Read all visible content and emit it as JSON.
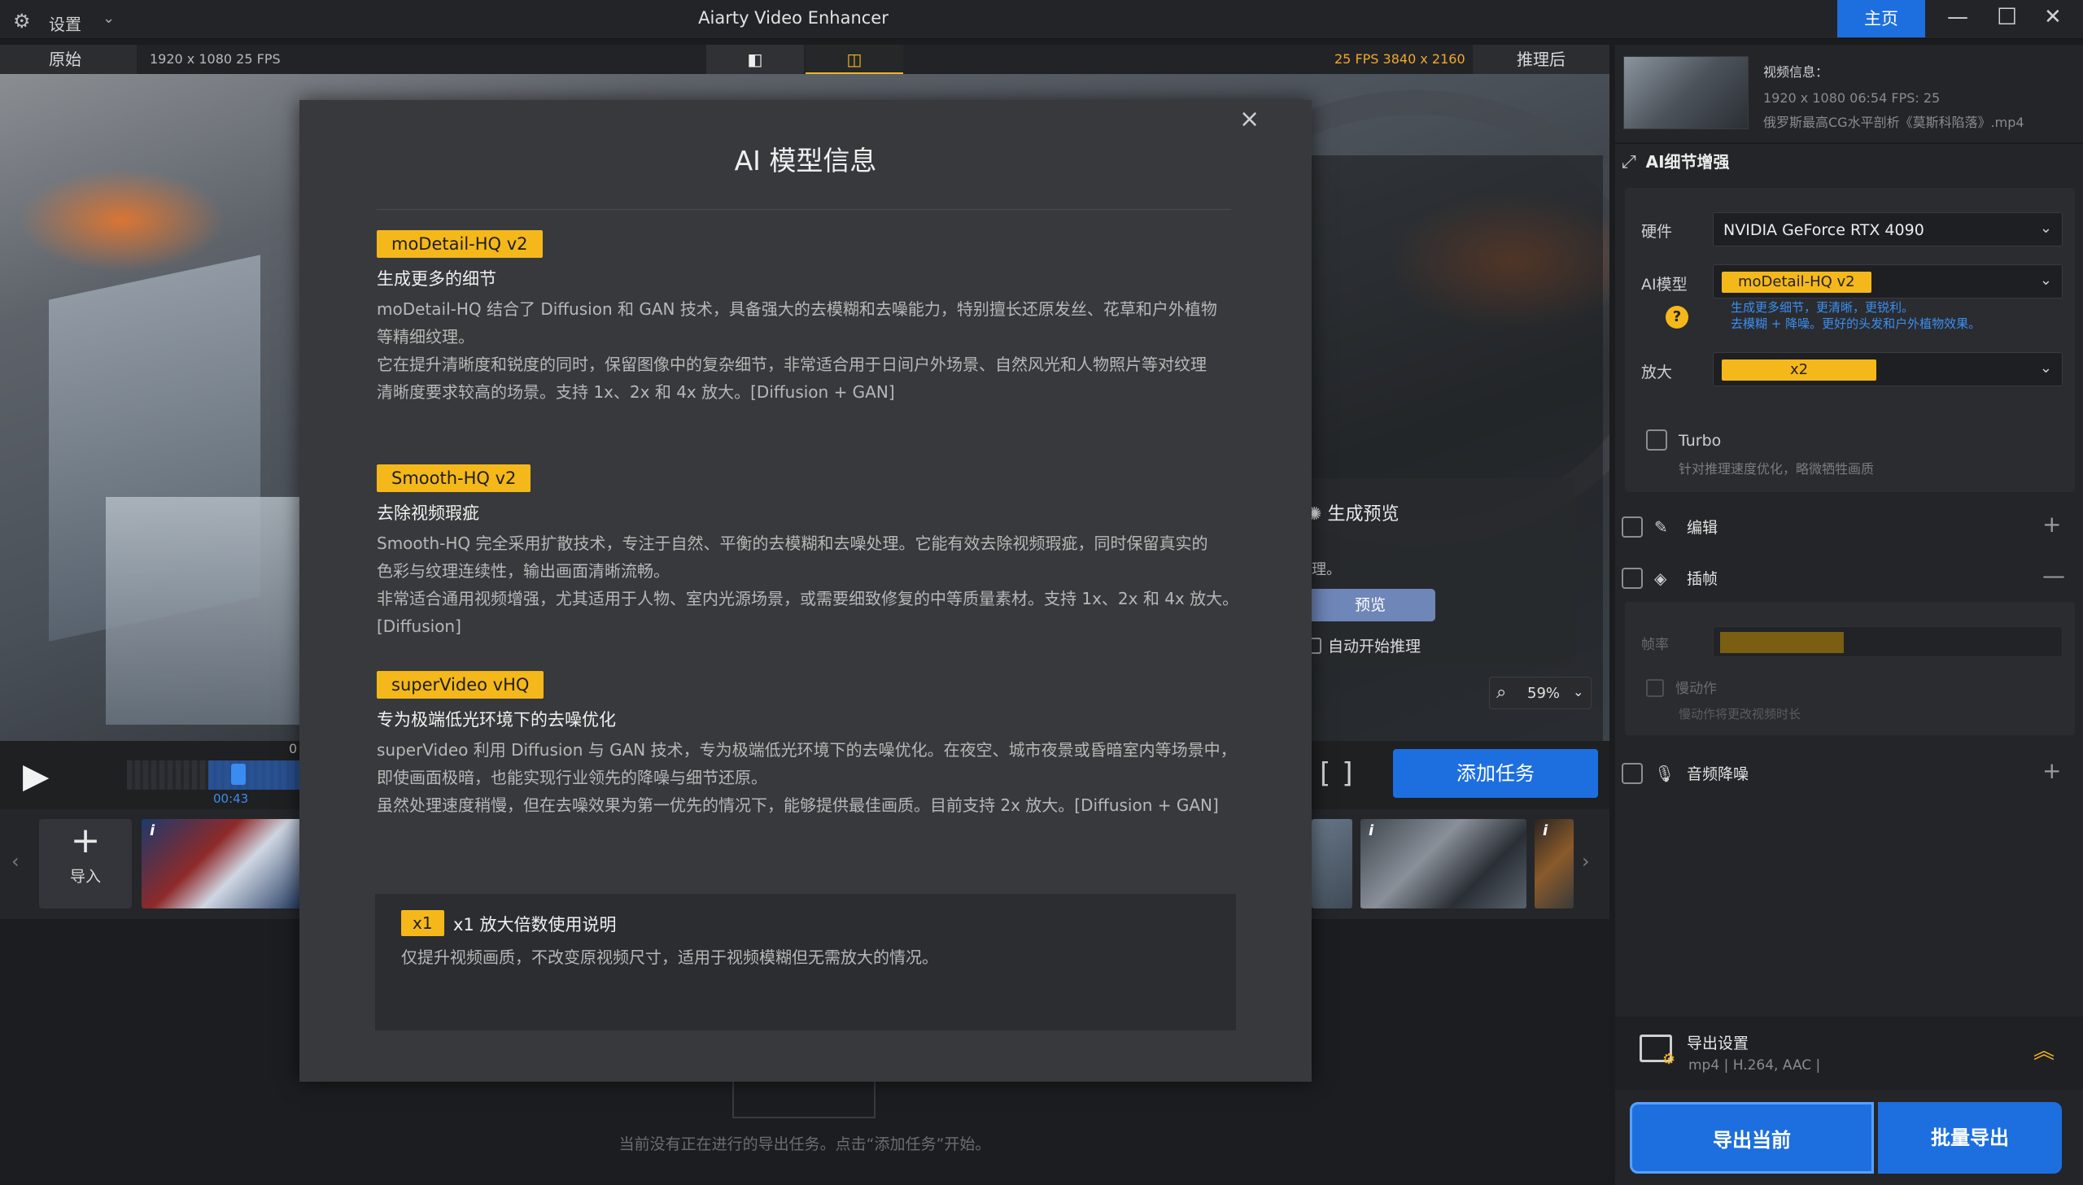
{
  "app": {
    "title": "Aiarty Video Enhancer",
    "settings_label": "设置",
    "home_button": "主页"
  },
  "preview": {
    "original_tab": "原始",
    "original_info": "1920 x 1080  25 FPS",
    "output_info": "25 FPS  3840 x 2160",
    "after_tab": "推理后",
    "generate_title": "生成预览",
    "generate_desc": "理。",
    "preview_button": "预览",
    "auto_start_label": "自动开始推理",
    "zoom_value": "59%",
    "time_label": "00:43",
    "time_zero": "0",
    "add_task_button": "添加任务"
  },
  "filmstrip": {
    "import_label": "导入"
  },
  "queue": {
    "empty_text": "当前没有正在进行的导出任务。点击“添加任务”开始。"
  },
  "right_panel": {
    "video_info_label": "视频信息：",
    "video_meta": "1920 x 1080  06:54    FPS: 25",
    "video_file": "俄罗斯最高CG水平剖析《莫斯科陷落》.mp4",
    "ai_section_title": "AI细节增强",
    "hardware_label": "硬件",
    "hardware_value": "NVIDIA GeForce RTX 4090",
    "model_label": "AI模型",
    "model_value": "moDetail-HQ  v2",
    "model_desc_line1": "生成更多细节，更清晰，更锐利。",
    "model_desc_line2": "去模糊 + 降噪。更好的头发和户外植物效果。",
    "scale_label": "放大",
    "scale_value": "x2",
    "turbo_label": "Turbo",
    "turbo_desc": "针对推理速度优化，略微牺牲画质",
    "edit_label": "编辑",
    "interp_label": "插帧",
    "interp_rate_label": "帧率",
    "interp_slow_label": "慢动作",
    "interp_slow_desc": "慢动作将更改视频时长",
    "audio_label": "音频降噪",
    "export_settings_title": "导出设置",
    "export_settings_sub": "mp4 | H.264, AAC |",
    "export_current": "导出当前",
    "export_batch": "批量导出"
  },
  "dialog": {
    "title": "AI 模型信息",
    "models": [
      {
        "tag": "moDetail-HQ  v2",
        "subtitle": "生成更多的细节",
        "p1": "moDetail-HQ 结合了 Diffusion 和 GAN 技术，具备强大的去模糊和去噪能力，特别擅长还原发丝、花草和户外植物",
        "p2": "等精细纹理。",
        "p3": "它在提升清晰度和锐度的同时，保留图像中的复杂细节，非常适合用于日间户外场景、自然风光和人物照片等对纹理",
        "p4": "清晰度要求较高的场景。支持 1x、2x 和 4x 放大。[Diffusion + GAN]"
      },
      {
        "tag": "Smooth-HQ  v2",
        "subtitle": "去除视频瑕疵",
        "p1": "Smooth-HQ 完全采用扩散技术，专注于自然、平衡的去模糊和去噪处理。它能有效去除视频瑕疵，同时保留真实的",
        "p2": "色彩与纹理连续性，输出画面清晰流畅。",
        "p3": "非常适合通用视频增强，尤其适用于人物、室内光源场景，或需要细致修复的中等质量素材。支持 1x、2x 和 4x 放大。",
        "p4": "[Diffusion]"
      },
      {
        "tag": "superVideo vHQ",
        "subtitle": "专为极端低光环境下的去噪优化",
        "p1": "superVideo 利用 Diffusion 与 GAN 技术，专为极端低光环境下的去噪优化。在夜空、城市夜景或昏暗室内等场景中，",
        "p2": "即使画面极暗，也能实现行业领先的降噪与细节还原。",
        "p3": "虽然处理速度稍慢，但在去噪效果为第一优先的情况下，能够提供最佳画质。目前支持 2x 放大。[Diffusion + GAN]",
        "p4": ""
      }
    ],
    "x1": {
      "tag": "x1",
      "title": "x1 放大倍数使用说明",
      "desc": "仅提升视频画质，不改变原视频尺寸，适用于视频模糊但无需放大的情况。"
    }
  }
}
